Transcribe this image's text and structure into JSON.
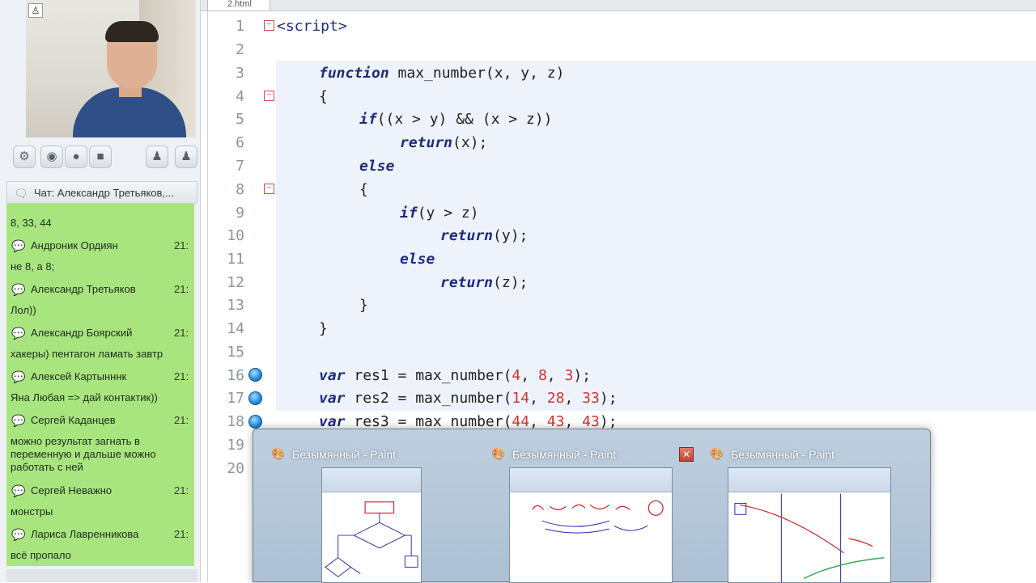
{
  "editor": {
    "tab_label": "2.html",
    "lines": [
      {
        "n": "1"
      },
      {
        "n": "2"
      },
      {
        "n": "3"
      },
      {
        "n": "4"
      },
      {
        "n": "5"
      },
      {
        "n": "6"
      },
      {
        "n": "7"
      },
      {
        "n": "8"
      },
      {
        "n": "9"
      },
      {
        "n": "10"
      },
      {
        "n": "11"
      },
      {
        "n": "12"
      },
      {
        "n": "13"
      },
      {
        "n": "14"
      },
      {
        "n": "15"
      },
      {
        "n": "16"
      },
      {
        "n": "17"
      },
      {
        "n": "18"
      },
      {
        "n": "19"
      },
      {
        "n": "20"
      }
    ],
    "code": {
      "l1": "<script>",
      "l3_kw": "function",
      "l3_rest": " max_number(x, y, z)",
      "l4": "{",
      "l5_kw": "if",
      "l5_rest": "((x > y) && (x > z))",
      "l6_kw": "return",
      "l6_rest": "(x);",
      "l7_kw": "else",
      "l8": "{",
      "l9_kw": "if",
      "l9_rest": "(y > z)",
      "l10_kw": "return",
      "l10_rest": "(y);",
      "l11_kw": "else",
      "l12_kw": "return",
      "l12_rest": "(z);",
      "l13": "}",
      "l14": "}",
      "l16": {
        "kw": "var",
        "name": " res1 = max_number(",
        "a": "4",
        "s1": ", ",
        "b": "8",
        "s2": ", ",
        "c": "3",
        "end": ");"
      },
      "l17": {
        "kw": "var",
        "name": " res2 = max_number(",
        "a": "14",
        "s1": ", ",
        "b": "28",
        "s2": ", ",
        "c": "33",
        "end": ");"
      },
      "l18": {
        "kw": "var",
        "name": " res3 = max_number(",
        "a": "44",
        "s1": ", ",
        "b": "43",
        "s2": ", ",
        "c": "43",
        "end": ");"
      }
    }
  },
  "chat": {
    "header": "Чат: Александр Третьяков,...",
    "messages": [
      {
        "author": "",
        "time": "",
        "text": "8, 33, 44"
      },
      {
        "author": "Андроник Ордиян",
        "time": "21:",
        "text": "не 8, а 8;"
      },
      {
        "author": "Александр Третьяков",
        "time": "21:",
        "text": "Лол))"
      },
      {
        "author": "Александр Боярский",
        "time": "21:",
        "text": "хакеры) пентагон ламать завтр"
      },
      {
        "author": "Алексей Картынннк",
        "time": "21:",
        "text": "Яна Любая => дай контактик))"
      },
      {
        "author": "Сергей Каданцев",
        "time": "21:",
        "text": "можно результат загнать в переменную и дальше можно работать с ней"
      },
      {
        "author": "Сергей Неважно",
        "time": "21:",
        "text": "монстры"
      },
      {
        "author": "Лариса Лавренникова",
        "time": "21:",
        "text": "всё пропало"
      }
    ]
  },
  "taskbar_preview": {
    "windows": [
      {
        "title": "Безымянный - Paint"
      },
      {
        "title": "Безымянный - Paint"
      },
      {
        "title": "Безымянный - Paint"
      }
    ],
    "close_glyph": "✕"
  },
  "icons": {
    "user": "user-icon",
    "chat": "speech-bubble-icon",
    "paint": "paint-palette-icon",
    "breakpoint": "breakpoint-icon"
  },
  "colors": {
    "chat_bg": "#a9e57e",
    "keyword": "#1d2b80",
    "number": "#d2322d",
    "highlight_line": "#eef3fb"
  }
}
